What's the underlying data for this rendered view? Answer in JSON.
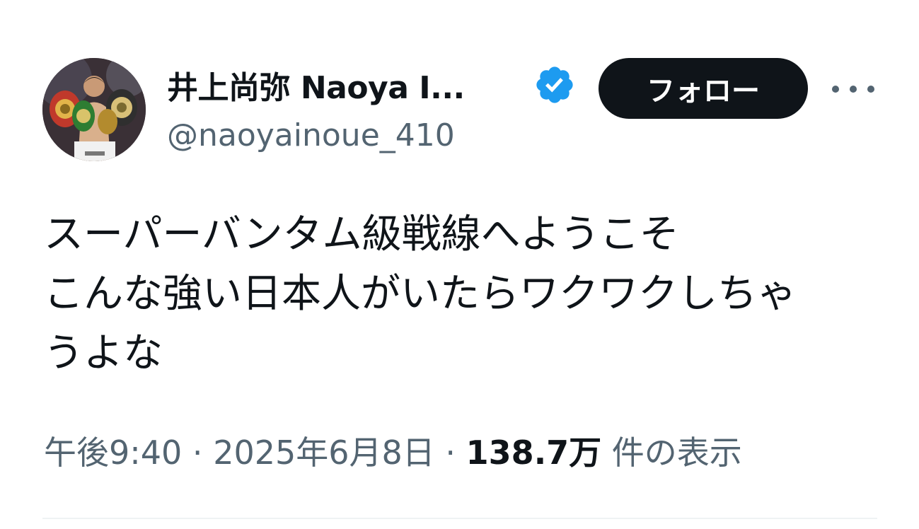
{
  "author": {
    "display_name": "井上尚弥 Naoya I...",
    "handle": "@naoyainoue_410",
    "verified_color": "#1d9bf0",
    "avatar_icon": "boxer-with-belts-avatar"
  },
  "actions": {
    "follow_label": "フォロー",
    "more_icon": "more-horizontal-icon"
  },
  "tweet": {
    "text": "スーパーバンタム級戦線へようこそ\nこんな強い日本人がいたらワクワクしちゃ\nうよな"
  },
  "meta": {
    "time": "午後9:40",
    "separator1": " · ",
    "date": "2025年6月8日",
    "separator2": " · ",
    "views_count": "138.7万",
    "views_label": " 件の表示"
  },
  "colors": {
    "text_primary": "#0f1419",
    "text_secondary": "#536471",
    "button_bg": "#0f1419",
    "divider": "#eff3f4"
  }
}
